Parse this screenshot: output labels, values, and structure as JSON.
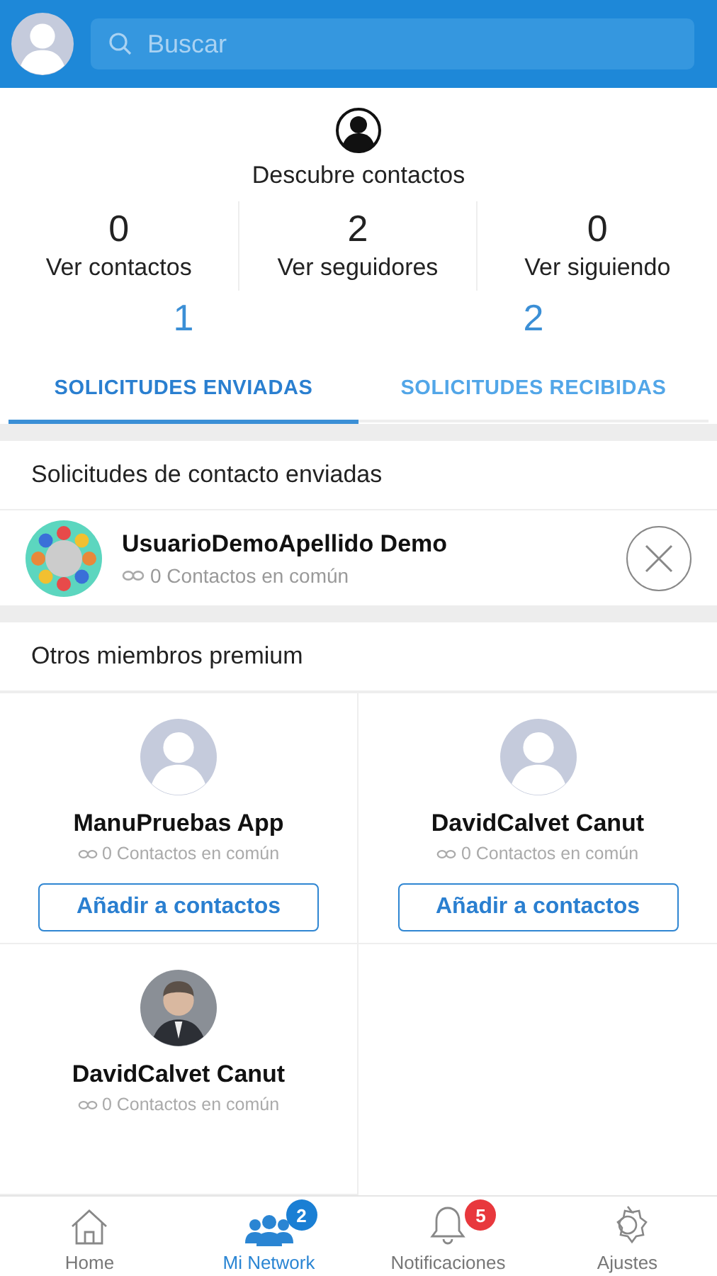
{
  "search": {
    "placeholder": "Buscar"
  },
  "discover": {
    "label": "Descubre contactos"
  },
  "stats": [
    {
      "value": "0",
      "label": "Ver contactos"
    },
    {
      "value": "2",
      "label": "Ver seguidores"
    },
    {
      "value": "0",
      "label": "Ver siguiendo"
    }
  ],
  "tabs": [
    {
      "count": "1",
      "label": "SOLICITUDES ENVIADAS",
      "selected": true
    },
    {
      "count": "2",
      "label": "SOLICITUDES RECIBIDAS",
      "selected": false
    }
  ],
  "sent_section": {
    "title": "Solicitudes de contacto enviadas",
    "requests": [
      {
        "name": "UsuarioDemoApellido Demo",
        "common": "0 Contactos en común"
      }
    ]
  },
  "premium_section": {
    "title": "Otros miembros premium",
    "members": [
      {
        "name": "ManuPruebas App",
        "common": "0 Contactos en común",
        "kind": "placeholder",
        "button": "Añadir a contactos"
      },
      {
        "name": "DavidCalvet Canut",
        "common": "0 Contactos en común",
        "kind": "placeholder",
        "button": "Añadir a contactos"
      },
      {
        "name": "DavidCalvet Canut",
        "common": "0 Contactos en común",
        "kind": "photo"
      }
    ]
  },
  "tab_bar": [
    {
      "kind": "home",
      "label": "Home",
      "selected": false
    },
    {
      "kind": "network",
      "label": "Mi Network",
      "selected": true,
      "badge": "2",
      "color": "#1a7fd4"
    },
    {
      "kind": "bell",
      "label": "Notificaciones",
      "selected": false,
      "badge": "5",
      "color": "#e8383d"
    },
    {
      "kind": "gear",
      "label": "Ajustes",
      "selected": false
    }
  ]
}
